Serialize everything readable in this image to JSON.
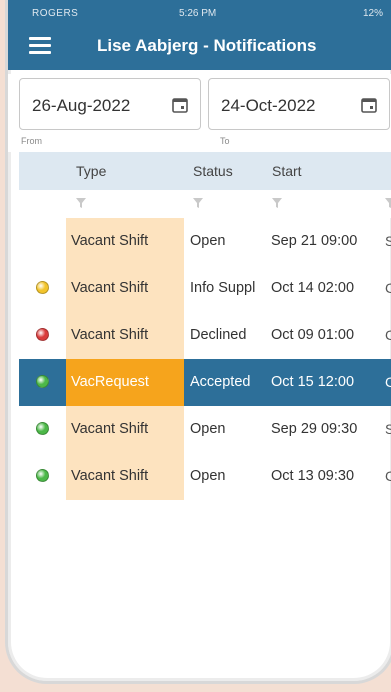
{
  "status_bar": {
    "carrier": "ROGERS",
    "time": "5:26 PM",
    "battery": "12%"
  },
  "header": {
    "title": "Lise Aabjerg - Notifications"
  },
  "filters": {
    "from": {
      "value": "26-Aug-2022",
      "label": "From"
    },
    "to": {
      "value": "24-Oct-2022",
      "label": "To"
    }
  },
  "columns": {
    "type": "Type",
    "status": "Status",
    "start": "Start"
  },
  "rows": [
    {
      "type": "Vacant Shift",
      "status": "Open",
      "start": "Sep 21 09:00",
      "more": "S",
      "dot": null
    },
    {
      "type": "Vacant Shift",
      "status": "Info Suppl",
      "start": "Oct 14 02:00",
      "more": "C",
      "dot": "#f2c42c"
    },
    {
      "type": "Vacant Shift",
      "status": "Declined",
      "start": "Oct 09 01:00",
      "more": "C",
      "dot": "#d93c3c"
    },
    {
      "type": "VacRequest",
      "status": "Accepted",
      "start": "Oct 15 12:00",
      "more": "C",
      "dot": "#4cb848"
    },
    {
      "type": "Vacant Shift",
      "status": "Open",
      "start": "Sep 29 09:30",
      "more": "S",
      "dot": "#4cb848"
    },
    {
      "type": "Vacant Shift",
      "status": "Open",
      "start": "Oct 13 09:30",
      "more": "C",
      "dot": "#4cb848"
    }
  ],
  "colors": {
    "header": "#2d6f99",
    "selected_row": "#2d6f99",
    "type_highlight": "#fde3bf",
    "selected_type": "#f6a41c"
  },
  "icons": {
    "menu": "hamburger-icon",
    "calendar": "calendar-icon",
    "filter": "filter-icon"
  }
}
